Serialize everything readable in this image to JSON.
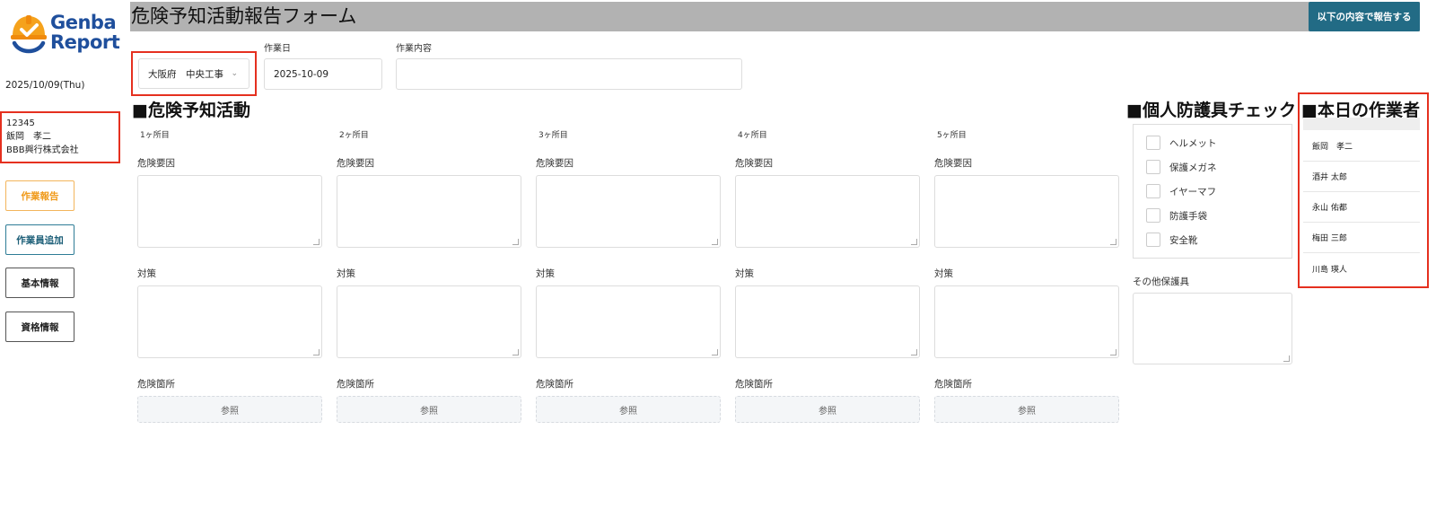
{
  "brand": {
    "logo_line1": "Genba",
    "logo_line2": "Report",
    "accent": "#f09a1a",
    "logo_blue": "#1f4f9c"
  },
  "sidebar": {
    "date": "2025/10/09(Thu)",
    "user": {
      "id": "12345",
      "name": "飯岡　孝二",
      "company": "BBB興行株式会社"
    },
    "nav": {
      "report": "作業報告",
      "add_worker": "作業員追加",
      "basic_info": "基本情報",
      "qualification": "資格情報"
    }
  },
  "header": {
    "title": "危険予知活動報告フォーム",
    "submit_label": "以下の内容で報告する"
  },
  "form": {
    "site_value": "大阪府　中央工事",
    "work_date_label": "作業日",
    "work_date_value": "2025-10-09",
    "work_content_label": "作業内容",
    "work_content_value": ""
  },
  "hazard": {
    "section_title": "■危険予知活動",
    "columns": [
      {
        "label": "1ヶ所目",
        "factor_label": "危険要因",
        "measure_label": "対策",
        "location_label": "危険箇所",
        "browse_label": "参照"
      },
      {
        "label": "2ヶ所目",
        "factor_label": "危険要因",
        "measure_label": "対策",
        "location_label": "危険箇所",
        "browse_label": "参照"
      },
      {
        "label": "3ヶ所目",
        "factor_label": "危険要因",
        "measure_label": "対策",
        "location_label": "危険箇所",
        "browse_label": "参照"
      },
      {
        "label": "4ヶ所目",
        "factor_label": "危険要因",
        "measure_label": "対策",
        "location_label": "危険箇所",
        "browse_label": "参照"
      },
      {
        "label": "5ヶ所目",
        "factor_label": "危険要因",
        "measure_label": "対策",
        "location_label": "危険箇所",
        "browse_label": "参照"
      }
    ]
  },
  "ppe": {
    "section_title": "■個人防護具チェック",
    "items": [
      "ヘルメット",
      "保護メガネ",
      "イヤーマフ",
      "防護手袋",
      "安全靴"
    ],
    "other_label": "その他保護具"
  },
  "workers": {
    "section_title": "■本日の作業者",
    "list": [
      "飯岡　孝二",
      "酒井 太郎",
      "永山 佑都",
      "梅田 三郎",
      "川島 瑛人"
    ]
  }
}
